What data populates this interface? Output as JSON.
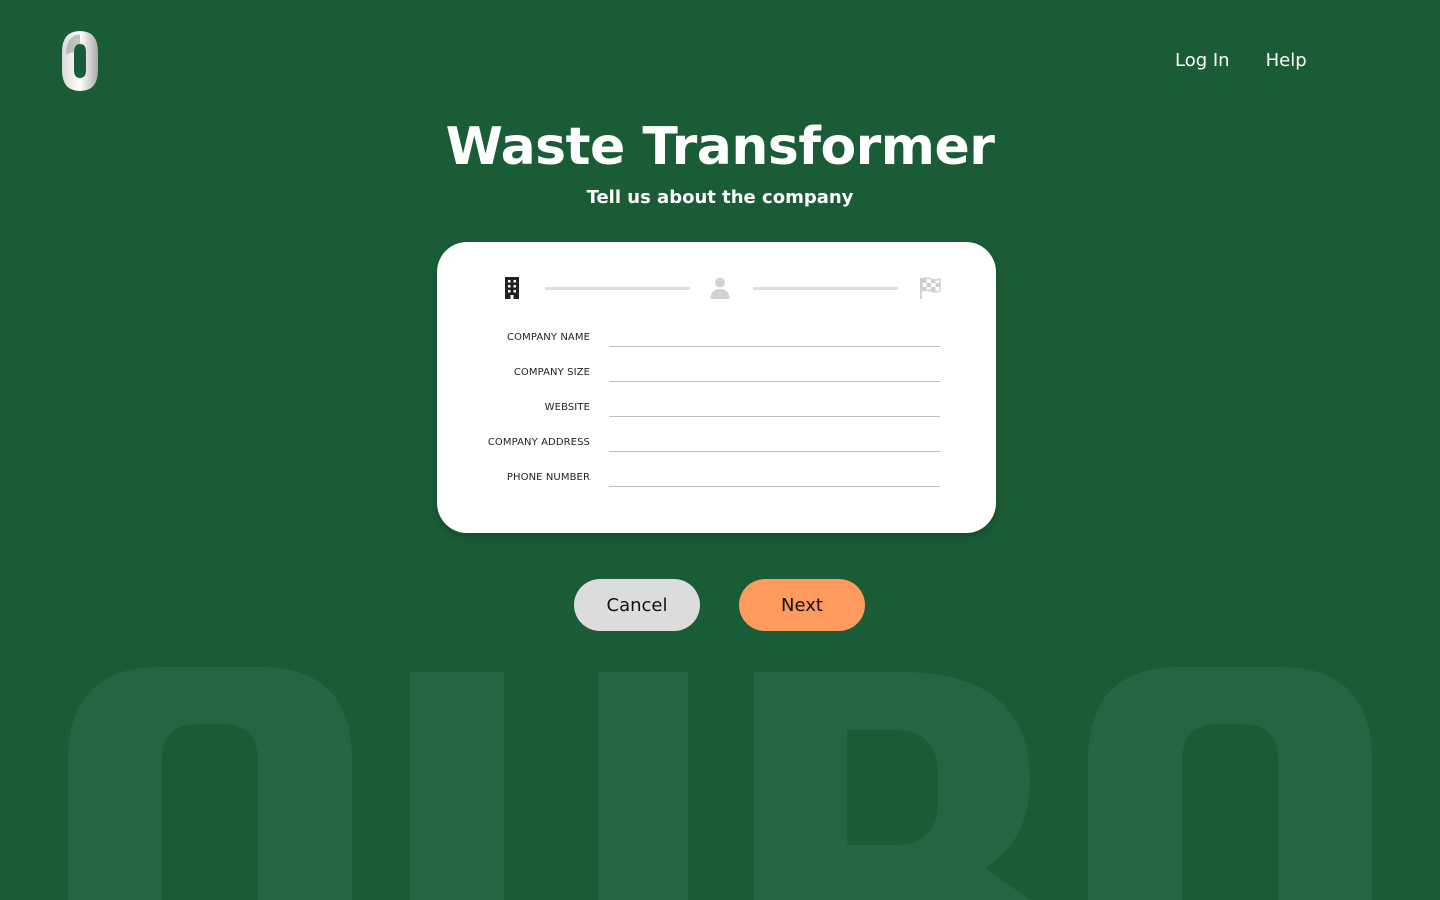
{
  "header": {
    "logo_icon": "zero-logo",
    "nav": [
      {
        "label": "Log In"
      },
      {
        "label": "Help"
      }
    ]
  },
  "main": {
    "title": "Waste Transformer",
    "subtitle": "Tell us about the company"
  },
  "stepper": {
    "steps": [
      {
        "icon": "building-icon",
        "state": "active"
      },
      {
        "icon": "person-icon",
        "state": "inactive"
      },
      {
        "icon": "checkered-flag-icon",
        "state": "inactive"
      }
    ]
  },
  "form": {
    "fields": [
      {
        "label": "COMPANY NAME",
        "value": ""
      },
      {
        "label": "COMPANY SIZE",
        "value": ""
      },
      {
        "label": "WEBSITE",
        "value": ""
      },
      {
        "label": "COMPANY ADDRESS",
        "value": ""
      },
      {
        "label": "PHONE NUMBER",
        "value": ""
      }
    ]
  },
  "buttons": {
    "cancel_label": "Cancel",
    "next_label": "Next"
  },
  "background": {
    "watermark_text": "OURO"
  },
  "colors": {
    "background": "#1a5c36",
    "accent": "#ff9a5e",
    "cancel": "#dcdcdc",
    "watermark": "#266541"
  }
}
